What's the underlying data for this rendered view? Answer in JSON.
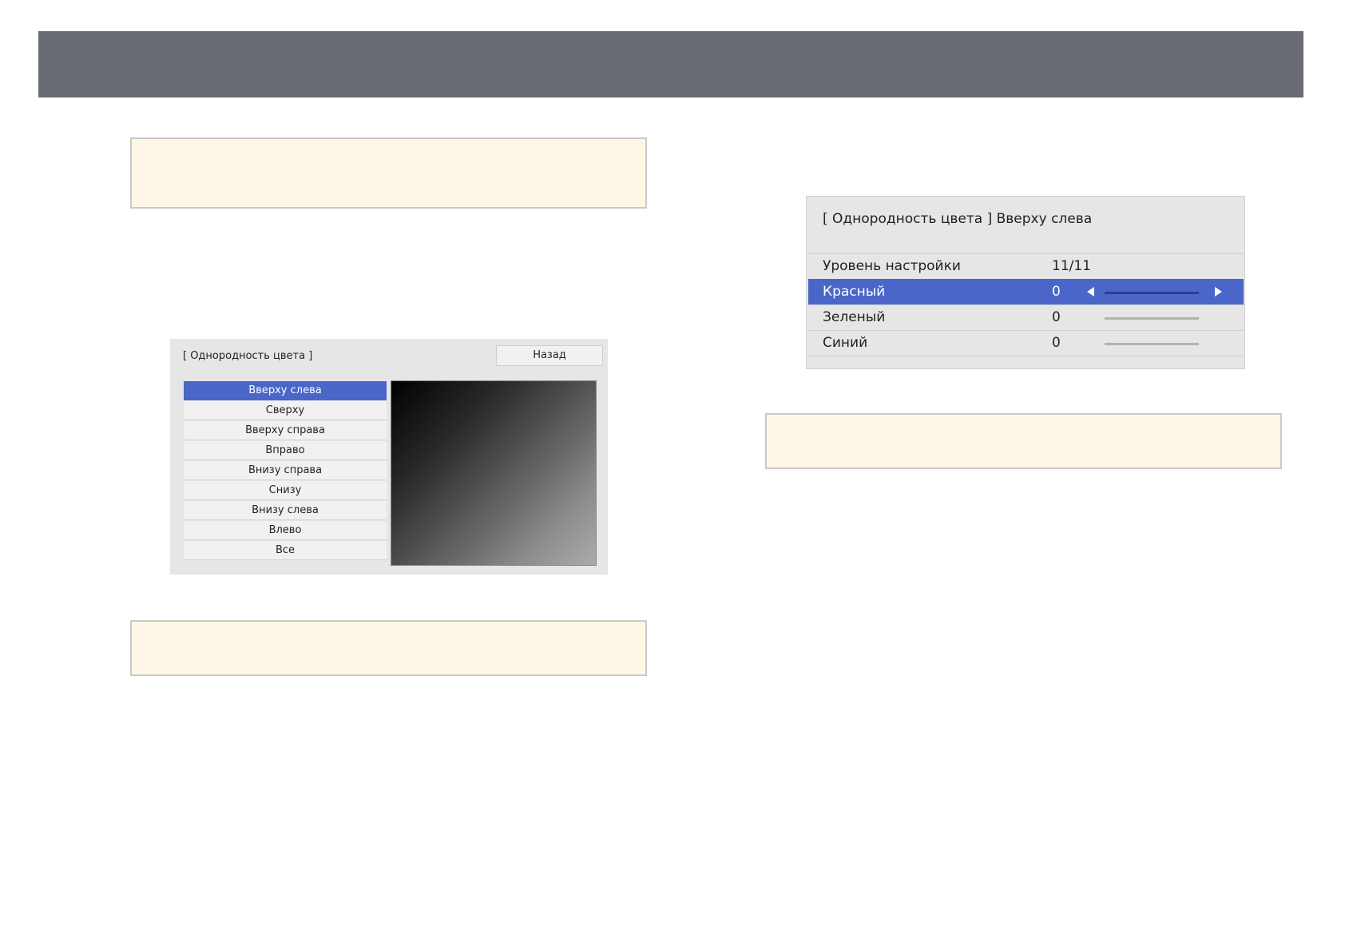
{
  "colors": {
    "header_bar": "#686b74",
    "note_background": "#fef7e6",
    "selection": "#4a66c8",
    "menu_background": "#e6e6e6"
  },
  "color_uniformity_menu": {
    "title": "[ Однородность цвета ]",
    "back_label": "Назад",
    "positions": [
      "Вверху слева",
      "Сверху",
      "Вверху справа",
      "Вправо",
      "Внизу справа",
      "Снизу",
      "Внизу слева",
      "Влево",
      "Все"
    ],
    "selected_index": 0
  },
  "adjust_menu": {
    "title": "[ Однородность цвета ] Вверху слева",
    "level": {
      "label": "Уровень настройки",
      "value": "11/11"
    },
    "channels": [
      {
        "label": "Красный",
        "value": "0",
        "selected": true
      },
      {
        "label": "Зеленый",
        "value": "0",
        "selected": false
      },
      {
        "label": "Синий",
        "value": "0",
        "selected": false
      }
    ]
  }
}
